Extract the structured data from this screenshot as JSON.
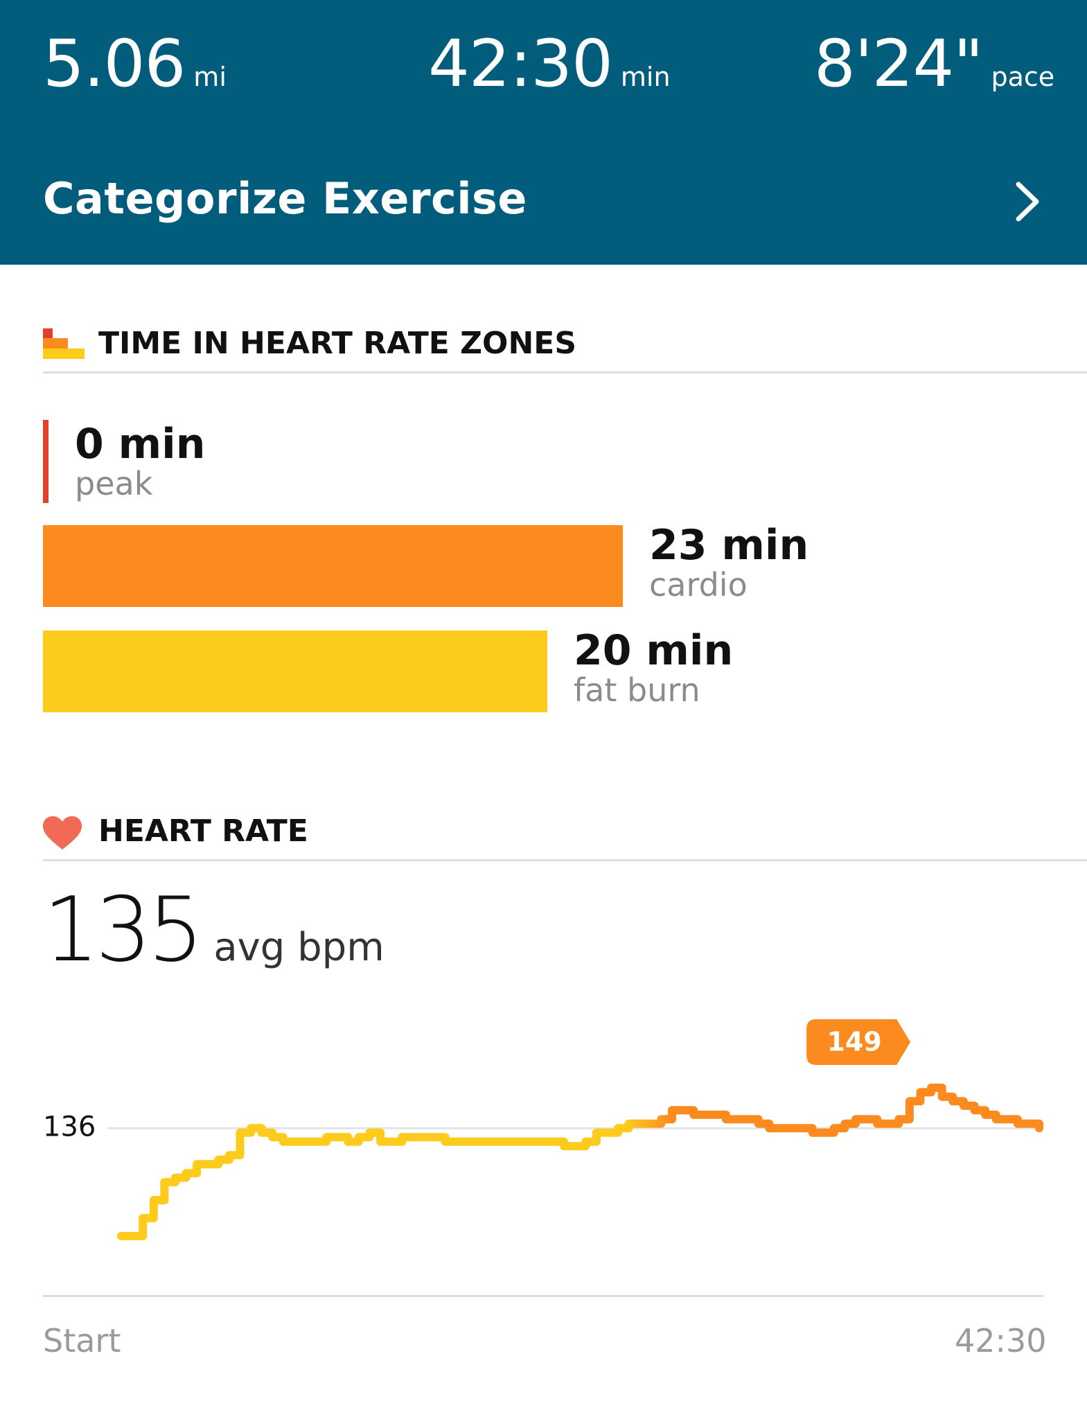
{
  "header": {
    "distance": {
      "value": "5.06",
      "unit": "mi"
    },
    "duration": {
      "value": "42:30",
      "unit": "min"
    },
    "pace": {
      "value": "8'24\"",
      "unit": "pace"
    },
    "categorize_label": "Categorize Exercise"
  },
  "zones": {
    "title": "TIME IN HEART RATE ZONES",
    "items": [
      {
        "minutes": "0 min",
        "name": "peak",
        "value": 0,
        "color": "#e2412b"
      },
      {
        "minutes": "23 min",
        "name": "cardio",
        "value": 23,
        "color": "#fb8a1f"
      },
      {
        "minutes": "20 min",
        "name": "fat burn",
        "value": 20,
        "color": "#fdcb1b"
      }
    ]
  },
  "heart_rate": {
    "title": "HEART RATE",
    "avg_value": "135",
    "avg_unit": "avg bpm"
  },
  "chart_data": {
    "type": "line",
    "title": "",
    "xlabel": "",
    "ylabel": "",
    "x_start_label": "Start",
    "x_end_label": "42:30",
    "reference_label": "136",
    "reference_value": 136,
    "peak_label": "149",
    "peak_value": 149,
    "x": [
      0.0,
      0.5,
      1.0,
      1.5,
      2.0,
      2.5,
      3.0,
      3.5,
      4.0,
      4.5,
      5.0,
      5.5,
      6.0,
      6.5,
      7.0,
      7.5,
      8.0,
      8.5,
      9.0,
      9.5,
      10.0,
      10.5,
      11.0,
      11.5,
      12.0,
      12.5,
      13.0,
      13.5,
      14.0,
      14.5,
      15.0,
      15.5,
      16.0,
      16.5,
      17.0,
      17.5,
      18.0,
      18.5,
      19.0,
      19.5,
      20.0,
      20.5,
      21.0,
      21.5,
      22.0,
      22.5,
      23.0,
      23.5,
      24.0,
      24.5,
      25.0,
      25.5,
      26.0,
      26.5,
      27.0,
      27.5,
      28.0,
      28.5,
      29.0,
      29.5,
      30.0,
      30.5,
      31.0,
      31.5,
      32.0,
      32.5,
      33.0,
      33.5,
      34.0,
      34.5,
      35.0,
      35.5,
      36.0,
      36.5,
      37.0,
      37.5,
      38.0,
      38.5,
      39.0,
      39.5,
      40.0,
      40.5,
      41.0,
      41.5,
      42.0,
      42.5
    ],
    "values": [
      112,
      112,
      116,
      120,
      124,
      125,
      126,
      128,
      128,
      129,
      130,
      135,
      136,
      135,
      134,
      133,
      133,
      133,
      133,
      134,
      134,
      133,
      134,
      135,
      133,
      133,
      134,
      134,
      134,
      134,
      133,
      133,
      133,
      133,
      133,
      133,
      133,
      133,
      133,
      133,
      133,
      132,
      132,
      133,
      135,
      135,
      136,
      137,
      137,
      137,
      138,
      140,
      140,
      139,
      139,
      139,
      138,
      138,
      138,
      137,
      136,
      136,
      136,
      136,
      135,
      135,
      136,
      137,
      138,
      138,
      137,
      137,
      138,
      142,
      144,
      145,
      143,
      142,
      141,
      140,
      139,
      138,
      138,
      137,
      137,
      136
    ]
  }
}
